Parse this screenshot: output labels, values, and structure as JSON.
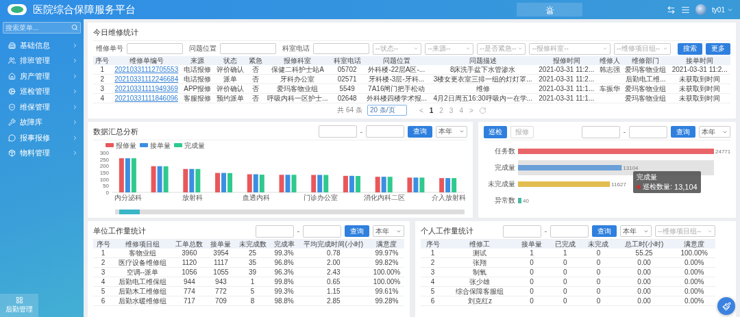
{
  "header": {
    "title": "医院综合保障服务平台",
    "user": "ty01"
  },
  "sidebar": {
    "search_placeholder": "搜索菜单...",
    "items": [
      {
        "label": "基础信息",
        "selected": false
      },
      {
        "label": "排班管理",
        "selected": false
      },
      {
        "label": "房产管理",
        "selected": false
      },
      {
        "label": "巡检管理",
        "selected": false
      },
      {
        "label": "维保管理",
        "selected": false
      },
      {
        "label": "故障库",
        "selected": false
      },
      {
        "label": "报事报修",
        "selected": false
      },
      {
        "label": "物料管理",
        "selected": false
      }
    ],
    "bottom_item": {
      "label": "后勤管理",
      "selected": true
    }
  },
  "repair_panel": {
    "title": "今日维修统计",
    "filters": [
      {
        "kind": "input",
        "label": "维修单号"
      },
      {
        "kind": "input",
        "label": "问题位置"
      },
      {
        "kind": "input",
        "label": "科室电话"
      },
      {
        "kind": "select",
        "placeholder": "--状态--"
      },
      {
        "kind": "select",
        "placeholder": "--来源--"
      },
      {
        "kind": "select",
        "placeholder": "--是否紧急--"
      },
      {
        "kind": "select",
        "placeholder": "--报修科室--"
      },
      {
        "kind": "select",
        "placeholder": "--维修项目组--"
      }
    ],
    "buttons": [
      "搜索",
      "更多"
    ],
    "table": {
      "columns": [
        {
          "label": "序号",
          "kind": "text"
        },
        {
          "label": "维修单编号",
          "kind": "link"
        },
        {
          "label": "来源",
          "kind": "text"
        },
        {
          "label": "状态",
          "kind": "text"
        },
        {
          "label": "紧急",
          "kind": "text"
        },
        {
          "label": "报修科室",
          "kind": "text"
        },
        {
          "label": "科室电话",
          "kind": "text"
        },
        {
          "label": "问题位置",
          "kind": "text"
        },
        {
          "label": "问题描述",
          "kind": "text"
        },
        {
          "label": "报修时间",
          "kind": "text"
        },
        {
          "label": "维修人",
          "kind": "text"
        },
        {
          "label": "维修部门",
          "kind": "text"
        },
        {
          "label": "接单时间",
          "kind": "text"
        }
      ],
      "rows": [
        [
          "1",
          "20210331112705553",
          "电话报修",
          "评价确认",
          "否",
          "保健二科护士站A",
          "05702",
          "外科楼-22层A区-...",
          "8床洗手盆下水管渗水",
          "2021-03-31 11:2...",
          "韩志强",
          "爱玛客物业组",
          "2021-03-31 11:2..."
        ],
        [
          "2",
          "20210331112246684",
          "电话报修",
          "派单",
          "否",
          "牙科办公室",
          "02571",
          "牙科楼-3层-牙科...",
          "3楼女更衣室三排一组的灯灯罩...",
          "2021-03-31 11:2...",
          null,
          "后勤电工维...",
          "未获取到时间"
        ],
        [
          "3",
          "20210331111949369",
          "APP报修",
          "评价确认",
          "否",
          "爱玛客物业组",
          "5549",
          "7A16闸门把手松动",
          "维修",
          "2021-03-31 11:1...",
          "车振华",
          "爱玛客物业组",
          "未获取到时间"
        ],
        [
          "4",
          "20210331111846096",
          "客服报修",
          "预约派单",
          "否",
          "呼吸内科一区护士...",
          "02648",
          "外科楼四楼学术报...",
          "4月2日周五16:30呼吸内一在学...",
          "2021-03-31 11:1...",
          null,
          "爱玛客物业组",
          "未获取到时间"
        ]
      ]
    },
    "pagination": {
      "total": "共 64 条",
      "page_size": "20 条/页",
      "prev": "<",
      "next": ">",
      "pages": [
        {
          "label": "1",
          "selected": true
        },
        {
          "label": "2",
          "selected": false
        },
        {
          "label": "3",
          "selected": false
        },
        {
          "label": "4",
          "selected": false
        }
      ]
    }
  },
  "summary_panel": {
    "title": "数据汇总分析",
    "range_separator": "-",
    "query_button": "查询",
    "period": "本年",
    "chart_data": {
      "type": "bar",
      "legend": "top",
      "categories": [
        "内分泌科",
        null,
        "放射科",
        null,
        "血透内科",
        null,
        "门诊办公室",
        null,
        "消化内科二区",
        null,
        "介入放射科"
      ],
      "ylim": [
        0,
        300
      ],
      "yticks": [
        0,
        50,
        100,
        150,
        200,
        250,
        300
      ],
      "series": [
        {
          "name": "报修量",
          "color": "#e8585b",
          "values": [
            258,
            198,
            177,
            147,
            137,
            133,
            132,
            125,
            118,
            112,
            108
          ]
        },
        {
          "name": "接单量",
          "color": "#3b8fe3",
          "values": [
            258,
            198,
            177,
            147,
            137,
            133,
            132,
            125,
            118,
            112,
            108
          ]
        },
        {
          "name": "完成量",
          "color": "#2fc98f",
          "values": [
            258,
            197,
            177,
            146,
            134,
            133,
            132,
            124,
            118,
            112,
            108
          ]
        }
      ]
    }
  },
  "inspection_panel": {
    "tabs": [
      {
        "label": "巡检",
        "selected": true
      },
      {
        "label": "报修",
        "selected": false
      }
    ],
    "range_separator": "-",
    "query_button": "查询",
    "period": "本年",
    "chart_data": {
      "type": "bar",
      "orientation": "horizontal",
      "data_labels": true,
      "categories": [
        "任务数",
        "完成量",
        "未完成量",
        "异常数"
      ],
      "series": [
        {
          "color": "#e8666a",
          "values": [
            24771,
            null,
            null,
            null
          ]
        },
        {
          "color": "#6a9fd8",
          "values": [
            null,
            13104,
            null,
            null
          ]
        },
        {
          "color": "#e2bd4f",
          "values": [
            null,
            null,
            11627,
            null
          ]
        },
        {
          "color": "#4bb8a8",
          "values": [
            null,
            null,
            null,
            40
          ]
        }
      ]
    },
    "hovered": [
      false,
      true,
      false,
      false
    ],
    "tooltip": {
      "title": "完成量",
      "label": "巡检数量:",
      "value": "13,104"
    }
  },
  "unit_panel": {
    "title": "单位工作量统计",
    "range_separator": "-",
    "query_button": "查询",
    "period": "本年",
    "table": {
      "columns": [
        "序号",
        "维修项目组",
        "工单总数",
        "接单量",
        "未完成数",
        "完成率",
        "平均完成时间(小时)",
        "满意度"
      ],
      "rows": [
        [
          "1",
          "客物业组",
          "3960",
          "3954",
          "25",
          "99.3%",
          "0.78",
          "99.97%"
        ],
        [
          "2",
          "医疗设备维修组",
          "1120",
          "1117",
          "35",
          "96.8%",
          "2.00",
          "99.82%"
        ],
        [
          "3",
          "空调--派单",
          "1056",
          "1055",
          "39",
          "96.3%",
          "2.43",
          "100.00%"
        ],
        [
          "4",
          "后勤电工维保组",
          "944",
          "943",
          "1",
          "99.8%",
          "0.65",
          "100.00%"
        ],
        [
          "5",
          "后勤木工维修组",
          "774",
          "772",
          "5",
          "99.3%",
          "1.15",
          "99.61%"
        ],
        [
          "6",
          "后勤水暖维修组",
          "717",
          "709",
          "8",
          "98.8%",
          "2.85",
          "99.28%"
        ]
      ]
    }
  },
  "person_panel": {
    "title": "个人工作量统计",
    "range_separator": "-",
    "query_button": "查询",
    "period": "本年",
    "group_placeholder": "--维修项目组--",
    "table": {
      "columns": [
        "序号",
        "维修工",
        "接单量",
        "已完成",
        "未完成",
        "总工时(小时)",
        "满意度"
      ],
      "rows": [
        [
          "1",
          "测试",
          "1",
          "1",
          "0",
          "55.25",
          "100.00%"
        ],
        [
          "2",
          "张翔",
          "0",
          "0",
          "0",
          "0.00",
          "0.00%"
        ],
        [
          "3",
          "制氧",
          "0",
          "0",
          "0",
          "0.00",
          "0.00%"
        ],
        [
          "4",
          "张少雄",
          "0",
          "0",
          "0",
          "0.00",
          "0.00%"
        ],
        [
          "5",
          "综合保障客服组",
          "0",
          "0",
          "0",
          "0.00",
          "0.00%"
        ],
        [
          "6",
          "刘克红z",
          "0",
          "0",
          "0",
          "0.00",
          "0.00%"
        ]
      ]
    }
  }
}
